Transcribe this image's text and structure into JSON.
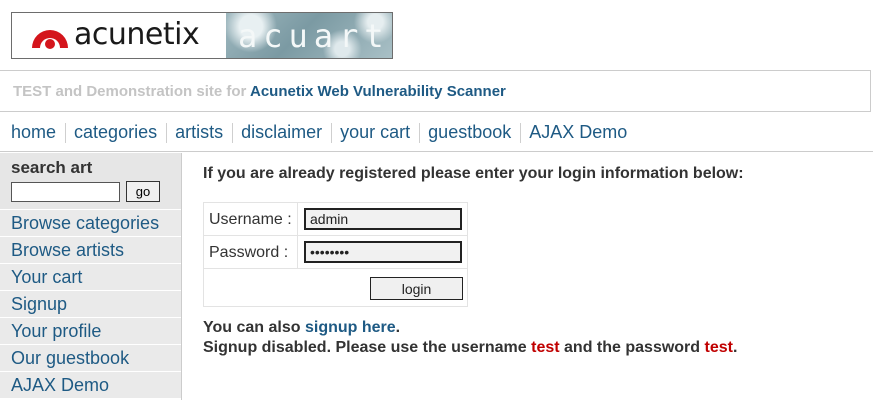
{
  "logo": {
    "brand_text": "acunetix",
    "art_text": "acuart"
  },
  "tagline": {
    "prefix": "TEST and Demonstration site for",
    "brand_link": "Acunetix Web Vulnerability Scanner"
  },
  "topnav": {
    "items": [
      {
        "label": "home"
      },
      {
        "label": "categories"
      },
      {
        "label": "artists"
      },
      {
        "label": "disclaimer"
      },
      {
        "label": "your cart"
      },
      {
        "label": "guestbook"
      },
      {
        "label": "AJAX Demo"
      }
    ]
  },
  "sidebar": {
    "search_title": "search art",
    "search_value": "",
    "go_label": "go",
    "items": [
      {
        "label": "Browse categories"
      },
      {
        "label": "Browse artists"
      },
      {
        "label": "Your cart"
      },
      {
        "label": "Signup"
      },
      {
        "label": "Your profile"
      },
      {
        "label": "Our guestbook"
      },
      {
        "label": "AJAX Demo"
      }
    ]
  },
  "main": {
    "intro": "If you are already registered please enter your login information below:",
    "username_label": "Username :",
    "username_value": "admin",
    "password_label": "Password :",
    "password_value": "********",
    "login_label": "login",
    "also_prefix": "You can also",
    "signup_link": "signup here",
    "also_suffix": ".",
    "disabled_prefix": "Signup disabled. Please use the username",
    "test_user": "test",
    "disabled_middle": "and the password",
    "test_pass": "test",
    "disabled_suffix": "."
  },
  "colors": {
    "link": "#1e5a84",
    "red": "#c00000",
    "muted": "#c4c4c4",
    "sidebar_bg": "#eaeaea"
  }
}
